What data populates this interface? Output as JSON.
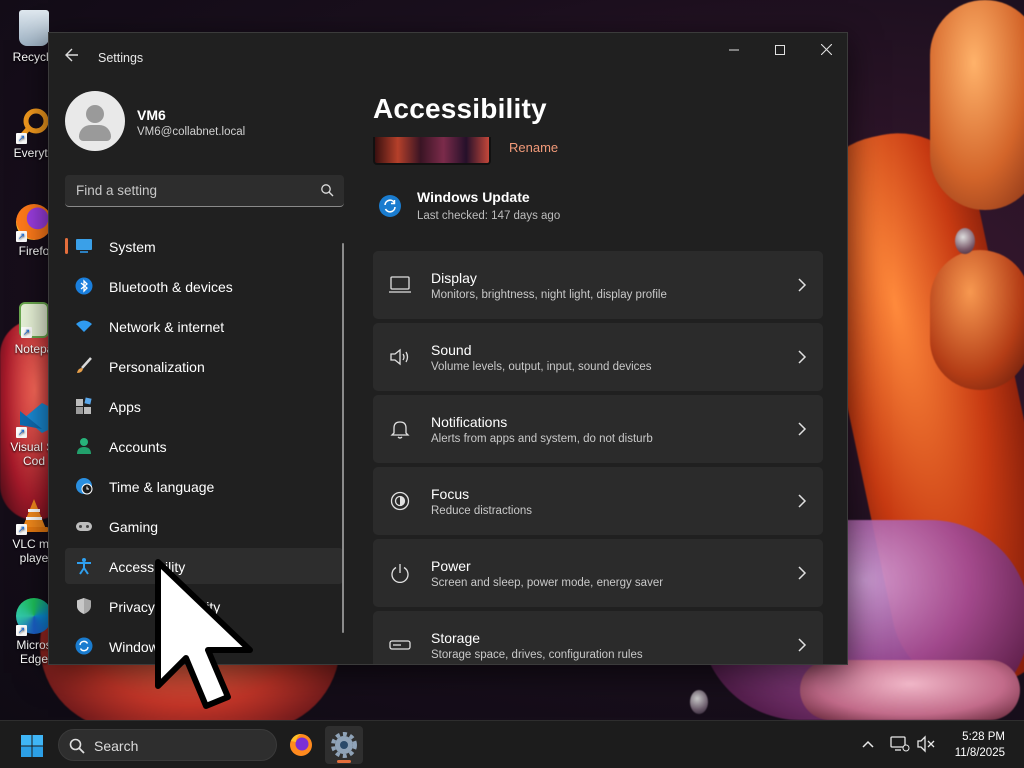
{
  "desktop": {
    "icons": [
      {
        "label": "Recycle",
        "icon": "recycle-bin-icon"
      },
      {
        "label": "Everyth",
        "icon": "everything-search-icon"
      },
      {
        "label": "Firefo",
        "icon": "firefox-icon"
      },
      {
        "label": "Notepa",
        "icon": "notepad-icon"
      },
      {
        "label": "Visual St",
        "label2": "Cod",
        "icon": "vscode-icon"
      },
      {
        "label": "VLC me",
        "label2": "playe",
        "icon": "vlc-icon"
      },
      {
        "label": "Micros",
        "label2": "Edge",
        "icon": "edge-icon"
      }
    ]
  },
  "window": {
    "title": "Settings",
    "controls": {
      "minimize": "—",
      "maximize": "☐",
      "close": "✕"
    }
  },
  "profile": {
    "name": "VM6",
    "email": "VM6@collabnet.local"
  },
  "search": {
    "placeholder": "Find a setting"
  },
  "nav": {
    "items": [
      {
        "label": "System",
        "icon": "system-monitor-icon"
      },
      {
        "label": "Bluetooth & devices",
        "icon": "bluetooth-icon"
      },
      {
        "label": "Network & internet",
        "icon": "wifi-icon"
      },
      {
        "label": "Personalization",
        "icon": "brush-icon"
      },
      {
        "label": "Apps",
        "icon": "apps-icon"
      },
      {
        "label": "Accounts",
        "icon": "accounts-icon"
      },
      {
        "label": "Time & language",
        "icon": "globe-clock-icon"
      },
      {
        "label": "Gaming",
        "icon": "gamepad-icon"
      },
      {
        "label": "Accessibility",
        "icon": "accessibility-icon"
      },
      {
        "label": "Privacy & security",
        "icon": "shield-icon"
      },
      {
        "label": "Windows Update",
        "icon": "update-icon"
      }
    ],
    "active_index": 8
  },
  "main": {
    "title": "Accessibility",
    "rename_label": "Rename",
    "windows_update": {
      "title": "Windows Update",
      "subtitle": "Last checked: 147 days ago"
    },
    "cards": [
      {
        "title": "Display",
        "subtitle": "Monitors, brightness, night light, display profile",
        "icon": "display-icon"
      },
      {
        "title": "Sound",
        "subtitle": "Volume levels, output, input, sound devices",
        "icon": "speaker-icon"
      },
      {
        "title": "Notifications",
        "subtitle": "Alerts from apps and system, do not disturb",
        "icon": "bell-icon"
      },
      {
        "title": "Focus",
        "subtitle": "Reduce distractions",
        "icon": "focus-icon"
      },
      {
        "title": "Power",
        "subtitle": "Screen and sleep, power mode, energy saver",
        "icon": "power-icon"
      },
      {
        "title": "Storage",
        "subtitle": "Storage space, drives, configuration rules",
        "icon": "storage-icon"
      }
    ]
  },
  "taskbar": {
    "search_label": "Search",
    "apps": [
      {
        "name": "firefox",
        "icon": "firefox-icon"
      },
      {
        "name": "settings",
        "icon": "settings-gear-icon",
        "active": true
      }
    ],
    "time": "5:28 PM",
    "date": "11/8/2025"
  },
  "colors": {
    "accent": "#e46e3c",
    "window_bg": "#202020",
    "card_bg": "#2b2b2b",
    "link": "#f29a79"
  }
}
